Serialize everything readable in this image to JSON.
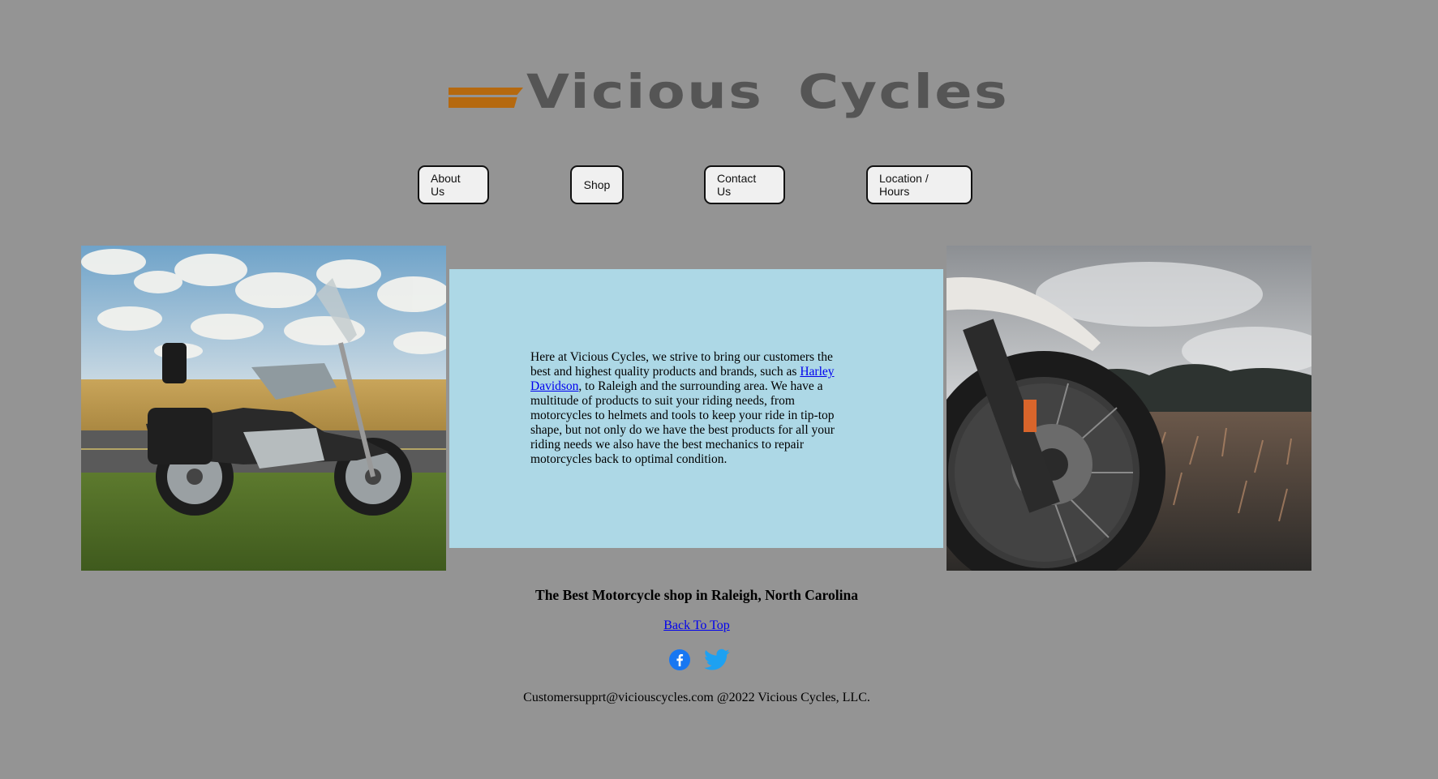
{
  "brand": {
    "name": "Vicious Cycles",
    "accent_color": "#b5690f",
    "text_color": "#555555"
  },
  "nav": {
    "items": [
      {
        "label": "About Us"
      },
      {
        "label": "Shop"
      },
      {
        "label": "Contact Us"
      },
      {
        "label": "Location / Hours"
      }
    ]
  },
  "images": {
    "left": {
      "icon": "motorcycle-cruiser-photo"
    },
    "right": {
      "icon": "motorcycle-wheel-photo"
    }
  },
  "info": {
    "text_before_link": "Here at Vicious Cycles, we strive to bring our customers the best and highest quality products and brands, such as ",
    "link_text": "Harley Davidson",
    "text_after_link": ", to Raleigh and the surrounding area. We have a multitude of products to suit your riding needs, from motorcycles to helmets and tools to keep your ride in tip-top shape, but not only do we have the best products for all your riding needs we also have the best mechanics to repair motorcycles back to optimal condition.",
    "background_color": "#add8e6"
  },
  "footer": {
    "tagline": "The Best Motorcycle shop in Raleigh, North Carolina",
    "back_to_top": "Back To Top",
    "social": [
      {
        "icon": "facebook-icon",
        "color": "#1877f2"
      },
      {
        "icon": "twitter-icon",
        "color": "#1da1f2"
      }
    ],
    "copyright": "Customersupprt@viciouscycles.com @2022 Vicious Cycles, LLC."
  },
  "page_background": "#949494"
}
